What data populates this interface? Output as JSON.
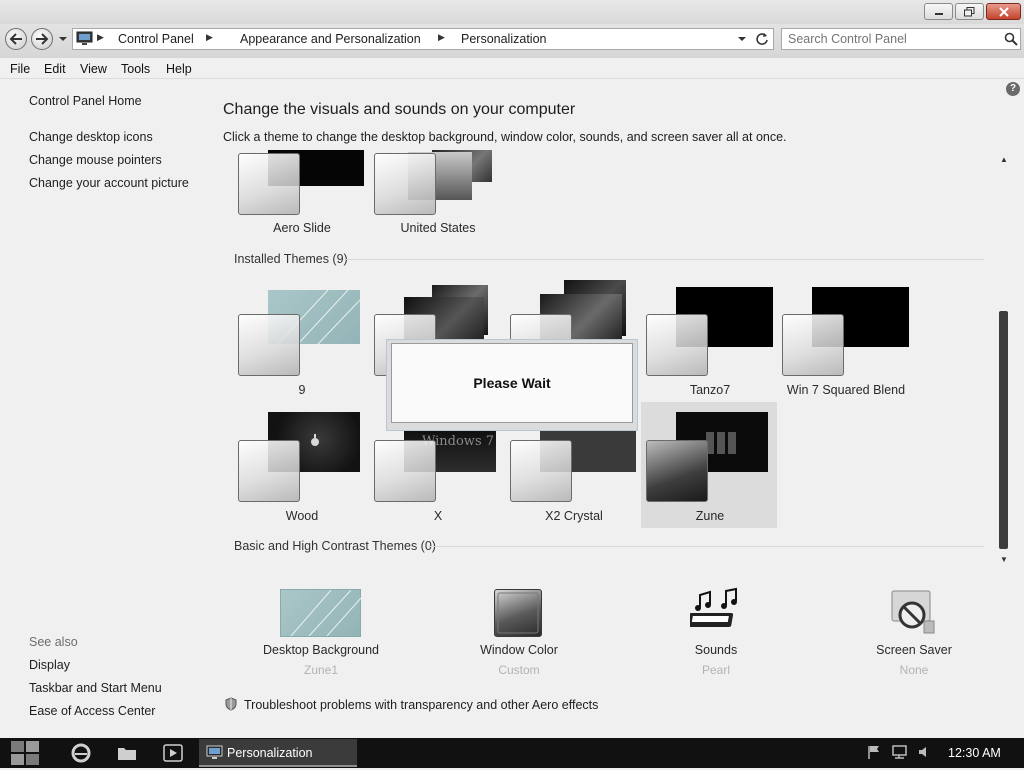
{
  "breadcrumb": [
    "Control Panel",
    "Appearance and Personalization",
    "Personalization"
  ],
  "search": {
    "placeholder": "Search Control Panel"
  },
  "menu": [
    "File",
    "Edit",
    "View",
    "Tools",
    "Help"
  ],
  "sidebar": {
    "home": "Control Panel Home",
    "links": [
      "Change desktop icons",
      "Change mouse pointers",
      "Change your account picture"
    ],
    "see_also_heading": "See also",
    "see_also": [
      "Display",
      "Taskbar and Start Menu",
      "Ease of Access Center"
    ]
  },
  "main": {
    "title": "Change the visuals and sounds on your computer",
    "subtitle": "Click a theme to change the desktop background, window color, sounds, and screen saver all at once.",
    "top_themes": [
      "Aero Slide",
      "United States"
    ],
    "installed_heading": "Installed Themes (9)",
    "installed_themes": [
      "9",
      "",
      "",
      "Tanzo7",
      "Win 7 Squared Blend",
      "Wood",
      "X",
      "X2 Crystal",
      "Zune"
    ],
    "basic_heading": "Basic and High Contrast Themes (0)",
    "selected_theme": "Zune",
    "windows7_wallpaper_text": "Windows 7"
  },
  "dialog": {
    "text": "Please Wait"
  },
  "bottom_items": [
    {
      "label": "Desktop Background",
      "value": "Zune1"
    },
    {
      "label": "Window Color",
      "value": "Custom"
    },
    {
      "label": "Sounds",
      "value": "Pearl"
    },
    {
      "label": "Screen Saver",
      "value": "None"
    }
  ],
  "troubleshoot": "Troubleshoot problems with transparency and other Aero effects",
  "help_symbol": "?",
  "taskbar": {
    "window_label": "Personalization",
    "clock": "12:30 AM"
  },
  "colors": {
    "taskbar": "#111111",
    "selection": "#dcdcdc",
    "dialog_border": "#b8c7d8"
  }
}
